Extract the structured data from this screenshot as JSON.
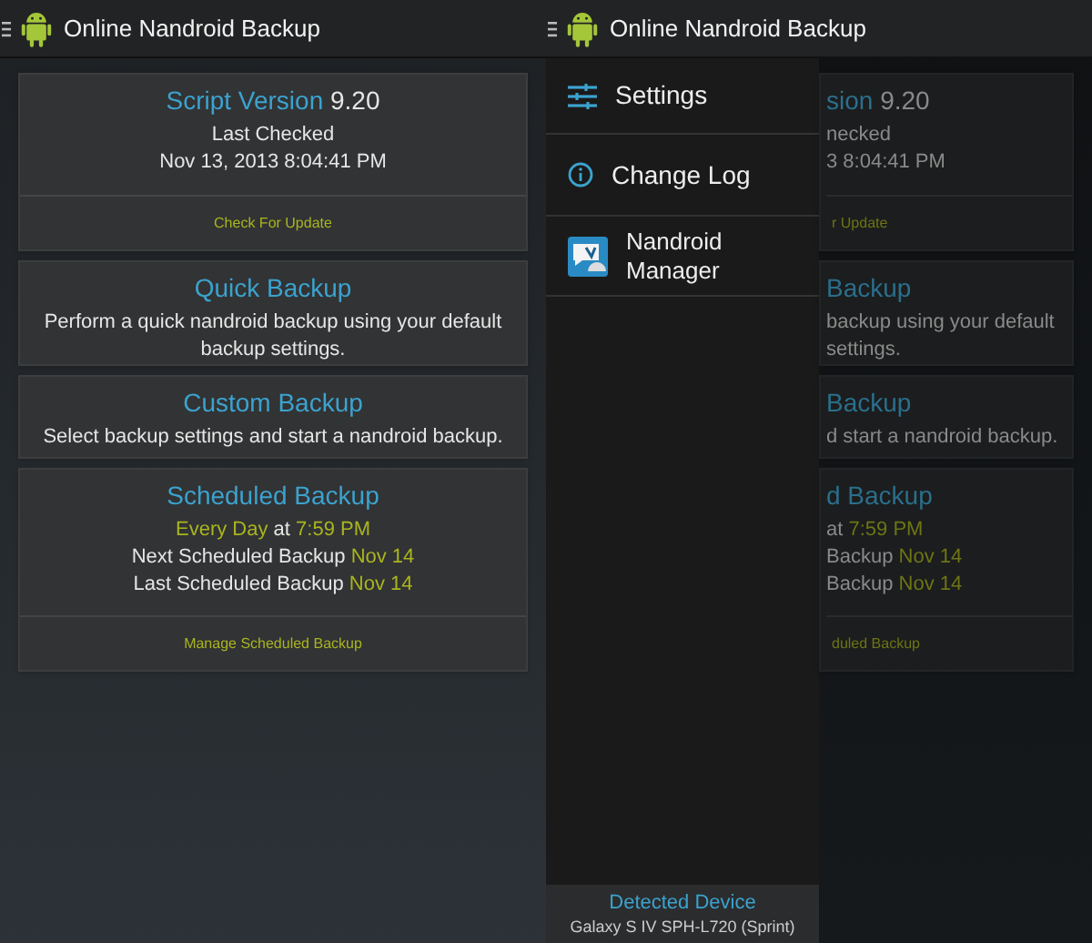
{
  "main": {
    "app_bar": {
      "title": "Online Nandroid Backup"
    },
    "cards": [
      {
        "lines": [
          {
            "kind": "title",
            "segments": [
              {
                "text": "Script Version",
                "color": "#3ba3cf"
              },
              {
                "text": "9.20",
                "color": "#e6e6e6"
              }
            ]
          },
          {
            "kind": "text",
            "segments": [
              {
                "text": "Last Checked",
                "color": "#e6e6e6"
              }
            ]
          },
          {
            "kind": "text",
            "segments": [
              {
                "text": "Nov 13, 2013 8:04:41 PM",
                "color": "#e6e6e6"
              }
            ]
          }
        ],
        "action": "Check For Update"
      },
      {
        "lines": [
          {
            "kind": "title",
            "segments": [
              {
                "text": "Quick Backup",
                "color": "#3ba3cf"
              }
            ]
          },
          {
            "kind": "text",
            "segments": [
              {
                "text": "Perform a quick nandroid backup using your default backup settings.",
                "color": "#e6e6e6"
              }
            ]
          }
        ]
      },
      {
        "lines": [
          {
            "kind": "title",
            "segments": [
              {
                "text": "Custom Backup",
                "color": "#3ba3cf"
              }
            ]
          },
          {
            "kind": "text",
            "segments": [
              {
                "text": "Select backup settings and start a nandroid backup.",
                "color": "#e6e6e6"
              }
            ]
          }
        ]
      },
      {
        "lines": [
          {
            "kind": "title",
            "segments": [
              {
                "text": "Scheduled Backup",
                "color": "#3ba3cf"
              }
            ]
          },
          {
            "kind": "text",
            "segments": [
              {
                "text": "Every Day",
                "color": "#a9b51f"
              },
              {
                "text": "at",
                "color": "#e6e6e6"
              },
              {
                "text": "7:59 PM",
                "color": "#a9b51f"
              }
            ]
          },
          {
            "kind": "text",
            "segments": [
              {
                "text": "Next Scheduled Backup",
                "color": "#e6e6e6"
              },
              {
                "text": "Nov 14",
                "color": "#a9b51f"
              }
            ]
          },
          {
            "kind": "text",
            "segments": [
              {
                "text": "Last Scheduled Backup",
                "color": "#e6e6e6"
              },
              {
                "text": "Nov 14",
                "color": "#a9b51f"
              }
            ]
          }
        ],
        "action": "Manage Scheduled Backup"
      }
    ]
  },
  "drawer_screen": {
    "app_bar": {
      "title": "Online Nandroid Backup"
    },
    "drawer": {
      "items": [
        {
          "kind": "settings",
          "label": "Settings"
        },
        {
          "kind": "info",
          "label": "Change Log"
        },
        {
          "kind": "app",
          "label": "Nandroid Manager"
        }
      ],
      "footer": {
        "label": "Detected Device",
        "device": "Galaxy S IV SPH-L720 (Sprint)"
      }
    },
    "behind_cards": [
      {
        "lines": [
          {
            "kind": "title",
            "segments": [
              {
                "text": "sion",
                "color": "#2a6f8c"
              },
              {
                "text": "9.20",
                "color": "#8a8a8a"
              }
            ]
          },
          {
            "kind": "text",
            "segments": [
              {
                "text": "necked",
                "color": "#8a8a8a"
              }
            ]
          },
          {
            "kind": "text",
            "segments": [
              {
                "text": "3 8:04:41 PM",
                "color": "#8a8a8a"
              }
            ]
          }
        ],
        "action": "r Update"
      },
      {
        "lines": [
          {
            "kind": "title",
            "segments": [
              {
                "text": "Backup",
                "color": "#2a6f8c"
              }
            ]
          },
          {
            "kind": "text",
            "segments": [
              {
                "text": "backup using your default",
                "color": "#8a8a8a"
              }
            ]
          },
          {
            "kind": "text",
            "segments": [
              {
                "text": "settings.",
                "color": "#8a8a8a"
              }
            ]
          }
        ]
      },
      {
        "lines": [
          {
            "kind": "title",
            "segments": [
              {
                "text": "Backup",
                "color": "#2a6f8c"
              }
            ]
          },
          {
            "kind": "text",
            "segments": [
              {
                "text": "d start a nandroid backup.",
                "color": "#8a8a8a"
              }
            ]
          }
        ]
      },
      {
        "lines": [
          {
            "kind": "title",
            "segments": [
              {
                "text": "d Backup",
                "color": "#2a6f8c"
              }
            ]
          },
          {
            "kind": "text",
            "segments": [
              {
                "text": "at",
                "color": "#8a8a8a"
              },
              {
                "text": "7:59 PM",
                "color": "#6d7514"
              }
            ]
          },
          {
            "kind": "text",
            "segments": [
              {
                "text": "Backup",
                "color": "#8a8a8a"
              },
              {
                "text": "Nov 14",
                "color": "#6d7514"
              }
            ]
          },
          {
            "kind": "text",
            "segments": [
              {
                "text": "Backup",
                "color": "#8a8a8a"
              },
              {
                "text": "Nov 14",
                "color": "#6d7514"
              }
            ]
          }
        ],
        "action": "duled Backup"
      }
    ]
  }
}
